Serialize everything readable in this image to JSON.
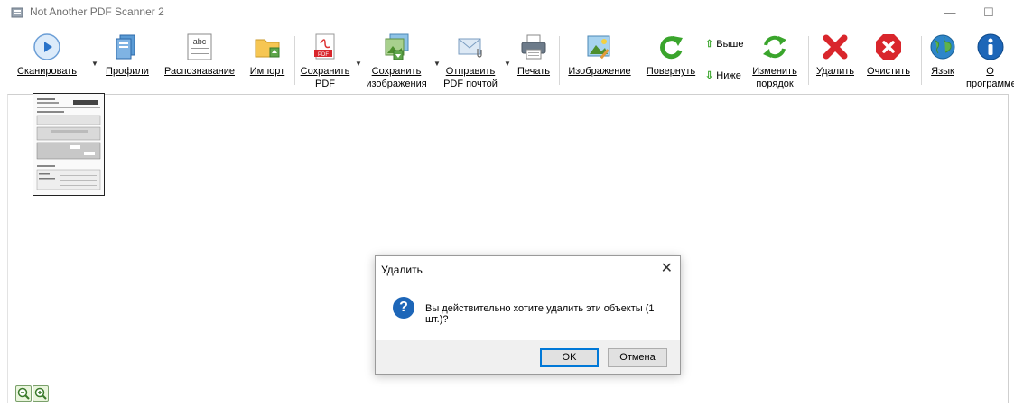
{
  "window": {
    "title": "Not Another PDF Scanner 2",
    "minimize": "—",
    "maximize": "☐"
  },
  "toolbar": {
    "scan": "Сканировать",
    "profiles": "Профили",
    "ocr": "Распознавание",
    "import": "Импорт",
    "save_pdf_1": "Сохранить",
    "save_pdf_2": "PDF",
    "save_images_1": "Сохранить",
    "save_images_2": "изображения",
    "email_pdf_1": "Отправить",
    "email_pdf_2": "PDF почтой",
    "print": "Печать",
    "image": "Изображение",
    "rotate": "Повернуть",
    "move_up": "Выше",
    "move_down": "Ниже",
    "reorder_1": "Изменить",
    "reorder_2": "порядок",
    "delete": "Удалить",
    "clear": "Очистить",
    "language": "Язык",
    "about_1": "О",
    "about_2": "программе",
    "abc_icon_text": "abc",
    "pdf_icon_text": "PDF"
  },
  "dialog": {
    "title": "Удалить",
    "close": "✕",
    "icon_glyph": "?",
    "message": "Вы действительно хотите удалить эти объекты (1 шт.)?",
    "ok": "OK",
    "cancel": "Отмена"
  },
  "icons": {
    "zoom_out": "zoom-out-icon",
    "zoom_in": "zoom-in-icon"
  },
  "colors": {
    "accent": "#0078d7",
    "delete_red": "#d9262c",
    "rotate_green": "#3aa52c",
    "help_blue": "#1d66b8"
  }
}
